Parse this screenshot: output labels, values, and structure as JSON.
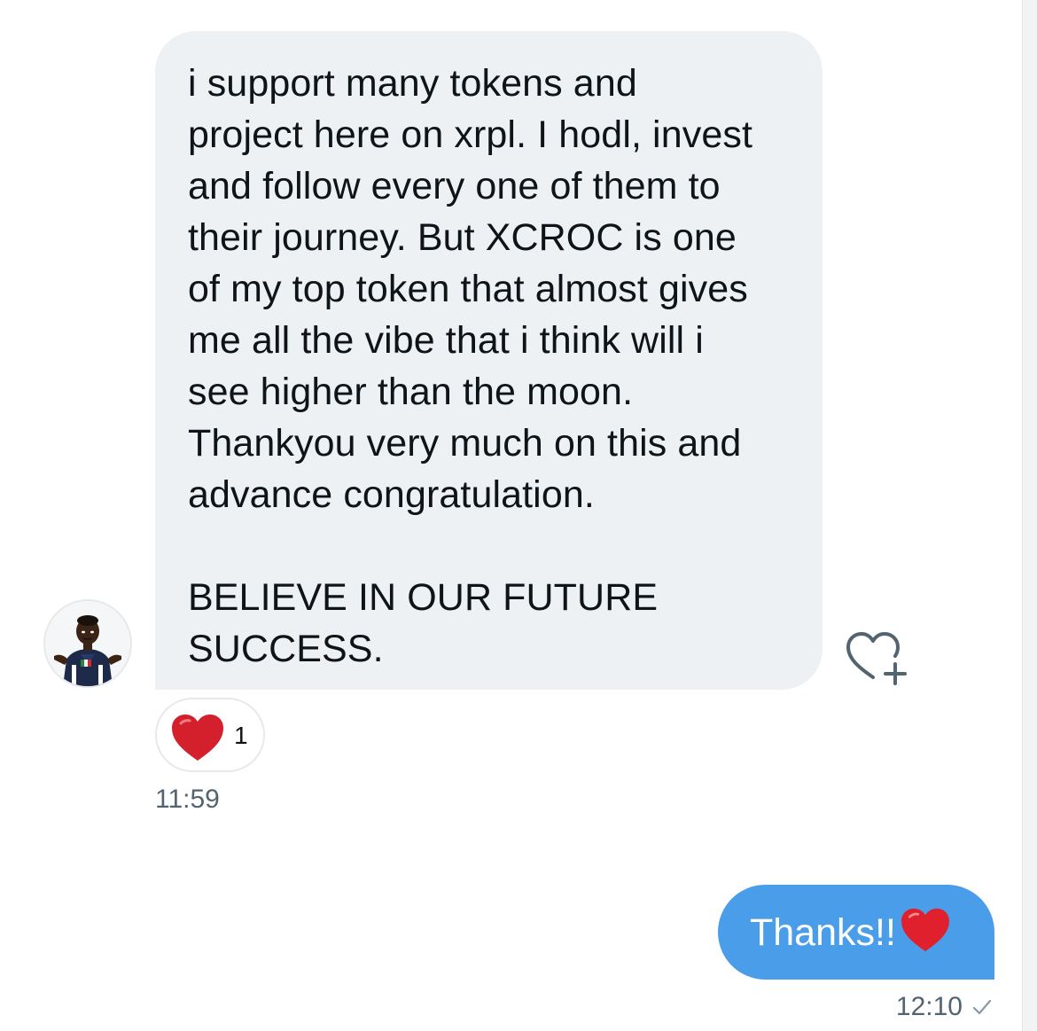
{
  "incoming_message": {
    "text": "i support many tokens and\nproject here on xrpl. I hodl, invest\nand follow every one of them to\ntheir journey. But XCROC is one\nof my top token that almost gives\nme all the vibe that i think will i\nsee higher than the moon.\nThankyou very much on this and\nadvance congratulation.\n\nBELIEVE IN OUR FUTURE\nSUCCESS.",
    "timestamp": "11:59",
    "reaction": {
      "emoji_icon": "red-heart-icon",
      "count": "1"
    },
    "add_reaction_icon": "heart-plus-icon"
  },
  "outgoing_message": {
    "text": "Thanks!!",
    "emoji_icon": "red-heart-icon",
    "timestamp": "12:10",
    "status_icon": "sent-check-icon"
  },
  "colors": {
    "incoming_bubble": "#eef1f3",
    "outgoing_bubble": "#4a9de9",
    "heart": "#e0245e",
    "timestamp_text": "#536471"
  }
}
